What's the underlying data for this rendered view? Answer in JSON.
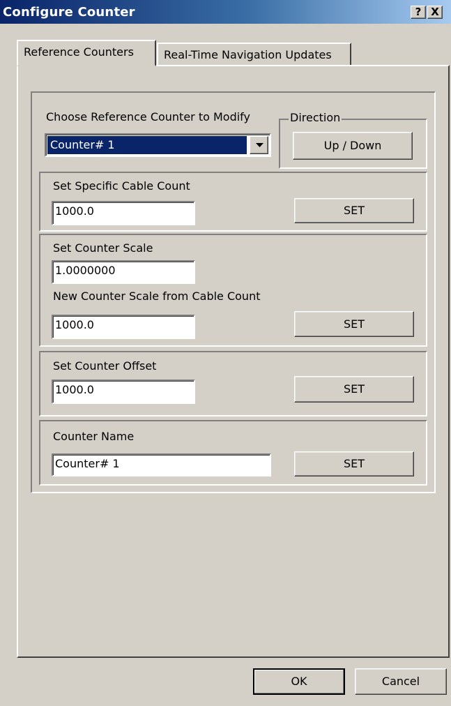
{
  "window": {
    "title": "Configure Counter",
    "help_button": "?",
    "close_button": "X"
  },
  "tabs": [
    {
      "label": "Reference Counters",
      "selected": true
    },
    {
      "label": "Real-Time Navigation Updates",
      "selected": false
    }
  ],
  "choose_counter": {
    "label": "Choose Reference Counter to Modify",
    "selected": "Counter# 1"
  },
  "direction": {
    "legend": "Direction",
    "button_label": "Up / Down"
  },
  "cable_count": {
    "label": "Set Specific Cable Count",
    "value": "1000.0",
    "set_label": "SET"
  },
  "counter_scale": {
    "label": "Set Counter Scale",
    "value": "1.0000000",
    "from_cable_label": "New Counter Scale from Cable Count",
    "from_cable_value": "1000.0",
    "set_label": "SET"
  },
  "counter_offset": {
    "label": "Set Counter Offset",
    "value": "1000.0",
    "set_label": "SET"
  },
  "counter_name": {
    "label": "Counter Name",
    "value": "Counter# 1",
    "set_label": "SET"
  },
  "footer": {
    "ok_label": "OK",
    "cancel_label": "Cancel"
  }
}
